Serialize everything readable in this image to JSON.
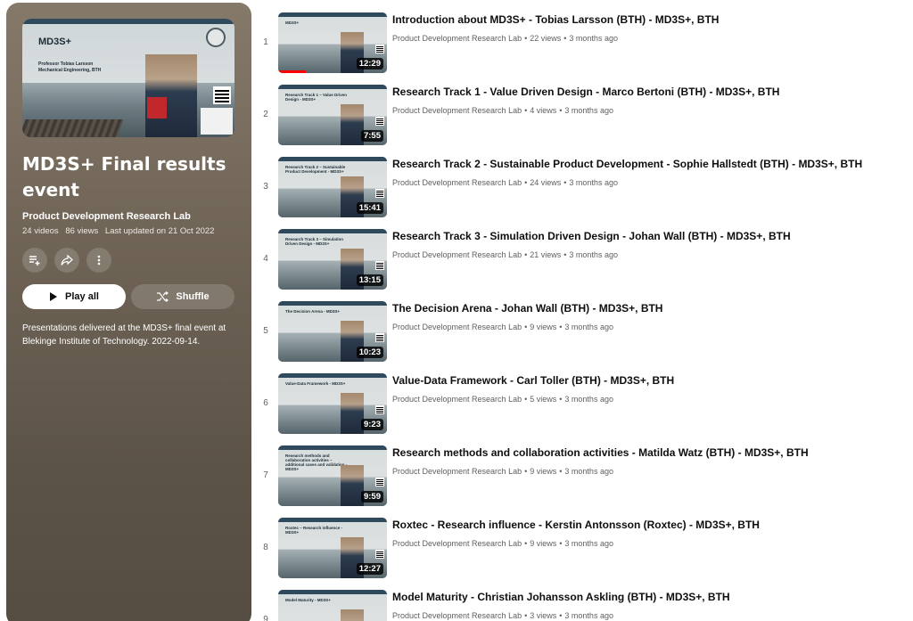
{
  "playlist": {
    "thumbnail": {
      "brand": "MD3S+",
      "slide_title": "Professor Tobias Larsson",
      "slide_subtitle": "Mechanical Engineering, BTH"
    },
    "title": "MD3S+ Final results event",
    "owner": "Product Development Research Lab",
    "video_count": "24 videos",
    "views": "86 views",
    "updated": "Last updated on 21 Oct 2022",
    "icons": [
      "add-to-queue-icon",
      "share-icon",
      "more-vert-icon"
    ],
    "play_all_label": "Play all",
    "shuffle_label": "Shuffle",
    "description": "Presentations delivered at the MD3S+ final event at Blekinge Institute of Technology. 2022-09-14.",
    "colors": {
      "panel": "#6e6355",
      "play_button": "#ffffff"
    }
  },
  "videos": [
    {
      "index": "1",
      "title": "Introduction about MD3S+ - Tobias Larsson (BTH) - MD3S+, BTH",
      "channel": "Product Development Research Lab",
      "views": "22 views",
      "age": "3 months ago",
      "duration": "12:29",
      "thumb_text": "MD3S+",
      "watched": 0.25
    },
    {
      "index": "2",
      "title": "Research Track 1 - Value Driven Design - Marco Bertoni (BTH) - MD3S+, BTH",
      "channel": "Product Development Research Lab",
      "views": "4 views",
      "age": "3 months ago",
      "duration": "7:55",
      "thumb_text": "Research Track 1 – Value Driven Design - MD3S+",
      "watched": 0
    },
    {
      "index": "3",
      "title": "Research Track 2 - Sustainable Product Development - Sophie Hallstedt (BTH) - MD3S+, BTH",
      "channel": "Product Development Research Lab",
      "views": "24 views",
      "age": "3 months ago",
      "duration": "15:41",
      "thumb_text": "Research Track 2 – Sustainable Product Development - MD3S+",
      "watched": 0
    },
    {
      "index": "4",
      "title": "Research Track 3 - Simulation Driven Design - Johan Wall (BTH) - MD3S+, BTH",
      "channel": "Product Development Research Lab",
      "views": "21 views",
      "age": "3 months ago",
      "duration": "13:15",
      "thumb_text": "Research Track 3 – Simulation Driven Design - MD3S+",
      "watched": 0
    },
    {
      "index": "5",
      "title": "The Decision Arena - Johan Wall (BTH) - MD3S+, BTH",
      "channel": "Product Development Research Lab",
      "views": "9 views",
      "age": "3 months ago",
      "duration": "10:23",
      "thumb_text": "The Decision Arena - MD3S+",
      "watched": 0
    },
    {
      "index": "6",
      "title": "Value-Data Framework - Carl Toller (BTH) - MD3S+, BTH",
      "channel": "Product Development Research Lab",
      "views": "5 views",
      "age": "3 months ago",
      "duration": "9:23",
      "thumb_text": "Value-Data Framework - MD3S+",
      "watched": 0
    },
    {
      "index": "7",
      "title": "Research methods and collaboration activities - Matilda Watz (BTH) - MD3S+, BTH",
      "channel": "Product Development Research Lab",
      "views": "9 views",
      "age": "3 months ago",
      "duration": "9:59",
      "thumb_text": "Research methods and collaboration activities – additional cases and validation - MD3S+",
      "watched": 0
    },
    {
      "index": "8",
      "title": "Roxtec - Research influence - Kerstin Antonsson (Roxtec) - MD3S+, BTH",
      "channel": "Product Development Research Lab",
      "views": "9 views",
      "age": "3 months ago",
      "duration": "12:27",
      "thumb_text": "Roxtec – Research influence - MD3S+",
      "watched": 0
    },
    {
      "index": "9",
      "title": "Model Maturity - Christian Johansson Askling (BTH) - MD3S+, BTH",
      "channel": "Product Development Research Lab",
      "views": "3 views",
      "age": "3 months ago",
      "duration": "",
      "thumb_text": "Model Maturity - MD3S+",
      "watched": 0
    }
  ]
}
